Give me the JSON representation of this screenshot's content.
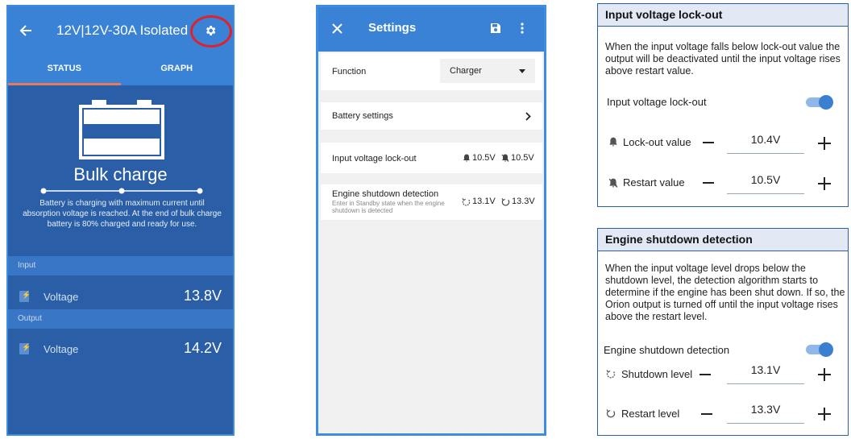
{
  "status_screen": {
    "title": "12V|12V-30A Isolated",
    "tabs": [
      "STATUS",
      "GRAPH"
    ],
    "state": "Bulk charge",
    "description": "Battery is charging with maximum current until absorption voltage is reached. At the end of bulk charge battery is  80% charged and ready for use.",
    "input_section": "Input",
    "output_section": "Output",
    "input_row": {
      "label": "Voltage",
      "value": "13.8V"
    },
    "output_row": {
      "label": "Voltage",
      "value": "14.2V"
    },
    "colors": {
      "appbar": "#3a82d5",
      "body": "#2a5fa7",
      "highlight_ring": "#e0212b"
    }
  },
  "settings_screen": {
    "title": "Settings",
    "function_label": "Function",
    "function_value": "Charger",
    "battery_settings": "Battery settings",
    "lockout_label": "Input voltage lock-out",
    "lockout_value": "10.5V",
    "restart_value": "10.5V",
    "engine_label": "Engine shutdown detection",
    "engine_sub": "Enter in Standby state when the engine shutdown is detected",
    "shutdown_value": "13.1V",
    "restart_level_value": "13.3V"
  },
  "lockout_panel": {
    "title": "Input voltage lock-out",
    "description": "When the input voltage falls below lock-out value the output will be deactivated until the input voltage rises above restart value.",
    "toggle_label": "Input voltage lock-out",
    "toggle_on": true,
    "rows": [
      {
        "label": "Lock-out value",
        "value": "10.4V"
      },
      {
        "label": "Restart value",
        "value": "10.5V"
      }
    ]
  },
  "engine_panel": {
    "title": "Engine shutdown detection",
    "description": "When the input voltage level drops below the shutdown level, the detection algorithm starts to determine if the engine has been shut down. If so, the Orion output is turned off until the input voltage rises above the restart level.",
    "toggle_label": "Engine shutdown detection",
    "toggle_on": true,
    "rows": [
      {
        "label": "Shutdown level",
        "value": "13.1V"
      },
      {
        "label": "Restart level",
        "value": "13.3V"
      }
    ]
  }
}
